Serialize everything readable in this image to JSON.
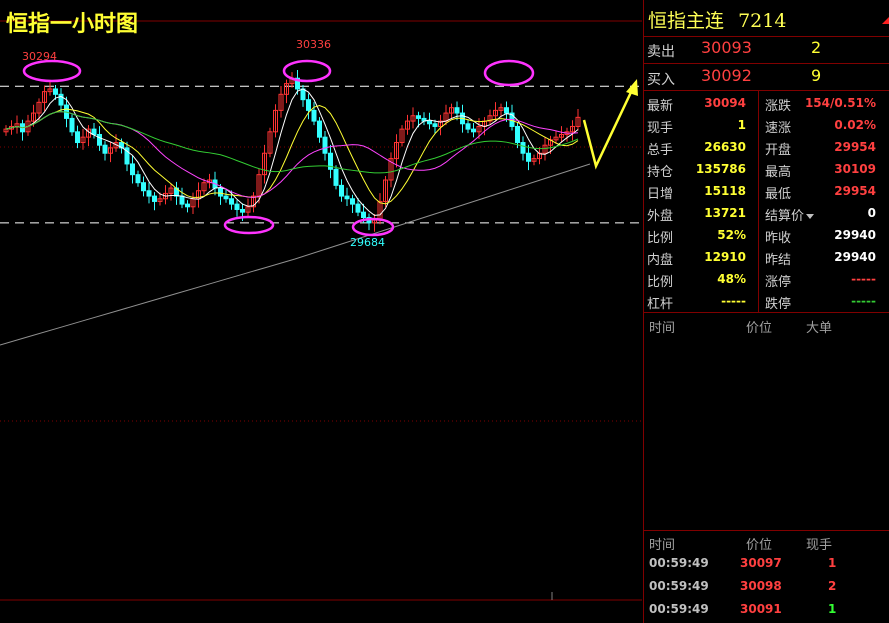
{
  "chart_data": {
    "type": "candlestick",
    "title": "恒指一小时图",
    "y_range": [
      29300,
      30450
    ],
    "resistance_level": 30210,
    "support_level": 29700,
    "annotations": [
      {
        "label": "30294",
        "color": "#ff4040",
        "kind": "peak"
      },
      {
        "label": "30336",
        "color": "#ff4040",
        "kind": "peak"
      },
      {
        "label": "29684",
        "color": "#33ffff",
        "kind": "trough"
      }
    ],
    "closes": [
      30050,
      30060,
      30070,
      30040,
      30080,
      30110,
      30150,
      30190,
      30200,
      30180,
      30140,
      30090,
      30040,
      30000,
      30020,
      30050,
      30030,
      29990,
      29960,
      29980,
      30000,
      29980,
      29920,
      29880,
      29850,
      29820,
      29800,
      29780,
      29790,
      29810,
      29830,
      29800,
      29770,
      29760,
      29790,
      29820,
      29850,
      29860,
      29830,
      29800,
      29790,
      29770,
      29750,
      29740,
      29760,
      29800,
      29880,
      29960,
      30040,
      30120,
      30180,
      30220,
      30240,
      30200,
      30160,
      30120,
      30080,
      30020,
      29960,
      29900,
      29840,
      29800,
      29790,
      29770,
      29740,
      29720,
      29700,
      29710,
      29780,
      29860,
      29940,
      30000,
      30050,
      30080,
      30100,
      30090,
      30080,
      30070,
      30060,
      30080,
      30110,
      30130,
      30110,
      30070,
      30050,
      30040,
      30060,
      30080,
      30100,
      30120,
      30130,
      30110,
      30060,
      30000,
      29960,
      29930,
      29940,
      29960,
      29990,
      30010,
      30020,
      30030,
      30040,
      30060,
      30094
    ]
  },
  "header": {
    "title": "恒指一小时图"
  },
  "symbol": {
    "name": "恒指主连",
    "code": "7214"
  },
  "quotes": {
    "ask_label": "卖出",
    "ask_price": "30093",
    "ask_volume": "2",
    "bid_label": "买入",
    "bid_price": "30092",
    "bid_volume": "9"
  },
  "stats": [
    {
      "l1": "最新",
      "v1": "30094",
      "c1": "#ff4040",
      "l2": "涨跌",
      "v2": "154/0.51%",
      "c2": "#ff4040"
    },
    {
      "l1": "现手",
      "v1": "1",
      "c1": "#ffff33",
      "l2": "速涨",
      "v2": "0.02%",
      "c2": "#ff4040"
    },
    {
      "l1": "总手",
      "v1": "26630",
      "c1": "#ffff33",
      "l2": "开盘",
      "v2": "29954",
      "c2": "#ff4040"
    },
    {
      "l1": "持仓",
      "v1": "135786",
      "c1": "#ffff33",
      "l2": "最高",
      "v2": "30109",
      "c2": "#ff4040"
    },
    {
      "l1": "日增",
      "v1": "15118",
      "c1": "#ffff33",
      "l2": "最低",
      "v2": "29954",
      "c2": "#ff4040"
    },
    {
      "l1": "外盘",
      "v1": "13721",
      "c1": "#ffff33",
      "l2": "结算价",
      "v2": "0",
      "c2": "#ffffff"
    },
    {
      "l1": "比例",
      "v1": "52%",
      "c1": "#ffff33",
      "l2": "昨收",
      "v2": "29940",
      "c2": "#ffffff"
    },
    {
      "l1": "内盘",
      "v1": "12910",
      "c1": "#ffff33",
      "l2": "昨结",
      "v2": "29940",
      "c2": "#ffffff"
    },
    {
      "l1": "比例",
      "v1": "48%",
      "c1": "#ffff33",
      "l2": "涨停",
      "v2": "-----",
      "c2": "#ff4040"
    },
    {
      "l1": "杠杆",
      "v1": "-----",
      "c1": "#ffff33",
      "l2": "跌停",
      "v2": "-----",
      "c2": "#33cc33"
    }
  ],
  "bigorders": {
    "time_h": "时间",
    "price_h": "价位",
    "big_h": "大单"
  },
  "ticks": {
    "time_h": "时间",
    "price_h": "价位",
    "vol_h": "现手",
    "rows": [
      {
        "time": "00:59:49",
        "price": "30097",
        "vol": "1",
        "vcolor": "#ff4040"
      },
      {
        "time": "00:59:49",
        "price": "30098",
        "vol": "2",
        "vcolor": "#ff4040"
      },
      {
        "time": "00:59:49",
        "price": "30091",
        "vol": "1",
        "vcolor": "#33ff33"
      }
    ]
  }
}
